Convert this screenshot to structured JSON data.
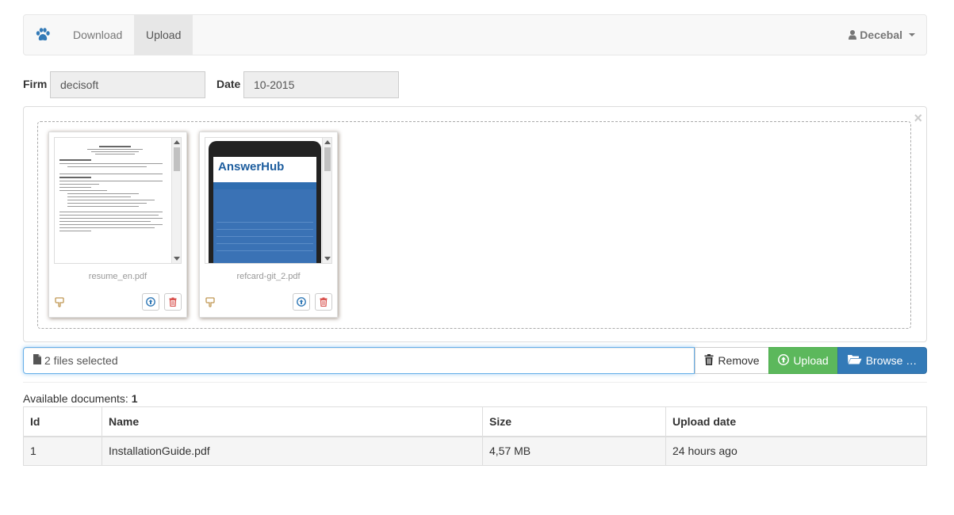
{
  "navbar": {
    "brand_icon": "paw-icon",
    "links": [
      {
        "label": "Download",
        "active": false
      },
      {
        "label": "Upload",
        "active": true
      }
    ],
    "user": {
      "icon": "user-icon",
      "name": "Decebal"
    }
  },
  "form": {
    "firm_label": "Firm",
    "firm_value": "decisoft",
    "date_label": "Date",
    "date_value": "10-2015"
  },
  "upload": {
    "close_symbol": "×",
    "files": [
      {
        "name": "resume_en.pdf",
        "preview": "document"
      },
      {
        "name": "refcard-git_2.pdf",
        "preview": "tablet"
      }
    ],
    "caption": "2 files selected",
    "remove_label": "Remove",
    "upload_label": "Upload",
    "browse_label": "Browse …"
  },
  "documents": {
    "available_label": "Available documents:",
    "available_count": "1",
    "columns": [
      "Id",
      "Name",
      "Size",
      "Upload date"
    ],
    "rows": [
      {
        "id": "1",
        "name": "InstallationGuide.pdf",
        "size": "4,57 MB",
        "date": "24 hours ago"
      }
    ]
  },
  "colors": {
    "success": "#5cb85c",
    "primary": "#337ab7",
    "brand": "#337ab7",
    "danger": "#d9534f"
  }
}
